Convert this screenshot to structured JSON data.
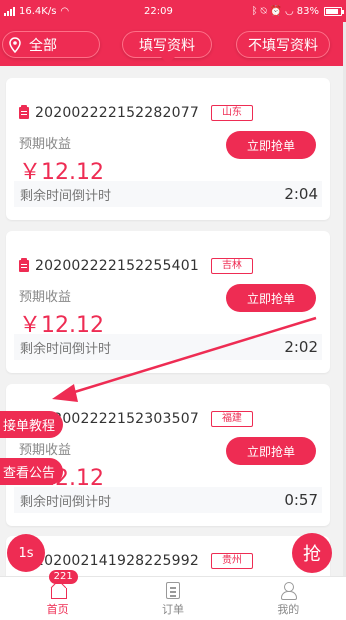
{
  "status_bar": {
    "network_speed": "16.4K/s",
    "time": "22:09",
    "battery": "83%"
  },
  "header": {
    "location_label": "全部",
    "tab_fill": "填写资料",
    "tab_nofill": "不填写资料"
  },
  "orders": [
    {
      "id": "202002222152282077",
      "region": "山东",
      "earn_label": "预期收益",
      "earn_value": "￥12.12",
      "button": "立即抢单",
      "countdown_label": "剩余时间倒计时",
      "countdown": "2:04"
    },
    {
      "id": "202002222152255401",
      "region": "吉林",
      "earn_label": "预期收益",
      "earn_value": "￥12.12",
      "button": "立即抢单",
      "countdown_label": "剩余时间倒计时",
      "countdown": "2:02"
    },
    {
      "id": "202002222152303507",
      "region": "福建",
      "earn_label": "预期收益",
      "earn_value": "￥12.12",
      "button": "立即抢单",
      "countdown_label": "剩余时间倒计时",
      "countdown": "0:57"
    },
    {
      "id": "202002141928225992",
      "region": "贵州"
    }
  ],
  "floating": {
    "tutorial": "接单教程",
    "announcement": "查看公告",
    "timer": "1s",
    "grab": "抢"
  },
  "bottom_nav": {
    "home": "首页",
    "home_badge": "221",
    "orders": "订单",
    "me": "我的"
  },
  "colors": {
    "brand": "#ee2c53"
  }
}
